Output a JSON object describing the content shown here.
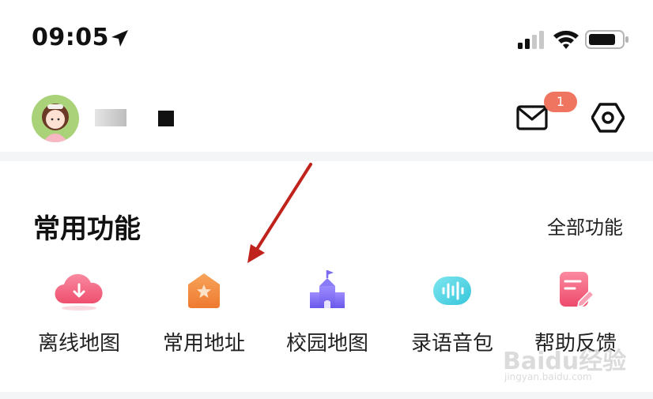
{
  "status_bar": {
    "time": "09:05",
    "icons": [
      "location-arrow-icon",
      "cellular-signal-icon",
      "wifi-icon",
      "battery-icon"
    ]
  },
  "header": {
    "avatar": "avatar-image",
    "mail_badge": "1",
    "icons": [
      "mail-icon",
      "settings-icon"
    ]
  },
  "section": {
    "title": "常用功能",
    "all_link": "全部功能"
  },
  "features": [
    {
      "label": "离线地图",
      "icon": "cloud-download-icon",
      "color": "#f0637f"
    },
    {
      "label": "常用地址",
      "icon": "home-star-icon",
      "color": "#f08a3c"
    },
    {
      "label": "校园地图",
      "icon": "campus-building-icon",
      "color": "#7b6cf2"
    },
    {
      "label": "录语音包",
      "icon": "voice-wave-icon",
      "color": "#4fd6e4"
    },
    {
      "label": "帮助反馈",
      "icon": "feedback-edit-icon",
      "color": "#f05f7d"
    }
  ],
  "annotation": {
    "color": "#c0231c"
  },
  "watermark": {
    "brand": "Baidu经验",
    "url": "jingyan.baidu.com"
  }
}
